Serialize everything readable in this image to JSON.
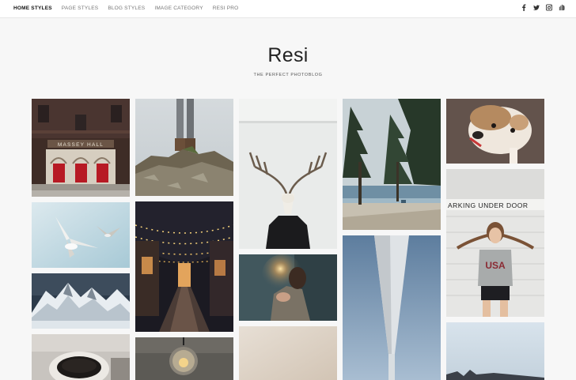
{
  "nav": {
    "items": [
      {
        "label": "HOME STYLES",
        "active": true
      },
      {
        "label": "PAGE STYLES",
        "active": false
      },
      {
        "label": "BLOG STYLES",
        "active": false
      },
      {
        "label": "IMAGE CATEGORY",
        "active": false
      },
      {
        "label": "RESI PRO",
        "active": false
      }
    ]
  },
  "social": [
    "facebook-icon",
    "twitter-icon",
    "instagram-icon",
    "soundcloud-icon"
  ],
  "header": {
    "title": "Resi",
    "tagline": "THE PERFECT PHOTOBLOG"
  },
  "gallery": {
    "signs": {
      "massey_hall": "MASSEY HALL",
      "parking_under_door": "ARKING UNDER DOOR",
      "tshirt": "USA"
    }
  },
  "colors": {
    "background": "#f7f7f7",
    "topbar": "#ffffff",
    "text": "#222222"
  }
}
